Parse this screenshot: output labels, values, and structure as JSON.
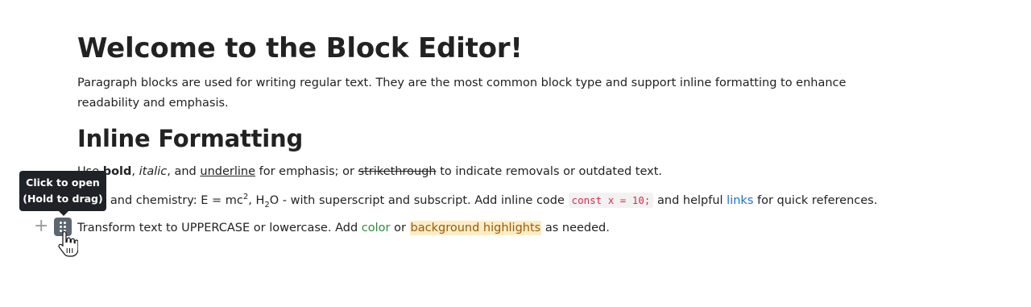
{
  "title": "Welcome to the Block Editor!",
  "intro": "Paragraph blocks are used for writing regular text. They are the most common block type and support inline formatting to enhance readability and emphasis.",
  "section_heading": "Inline Formatting",
  "line1": {
    "prefix": "Use ",
    "bold": "bold",
    "sep1": ", ",
    "italic": "italic",
    "sep2": ", and ",
    "underline": "underline",
    "mid": " for emphasis; or ",
    "strike": "strikethrough",
    "suffix": " to indicate removals or outdated text."
  },
  "line2": {
    "prefix": "Math and chemistry: E = mc",
    "sup": "2",
    "mid1": ", H",
    "sub": "2",
    "mid2": "O - with superscript and subscript. Add inline code ",
    "code": "const x = 10;",
    "mid3": " and helpful ",
    "link": "links",
    "suffix": " for quick references."
  },
  "line3": {
    "prefix": "Transform text to UPPERCASE or lowercase. Add ",
    "color": "color",
    "mid": " or ",
    "highlight": "background highlights",
    "suffix": " as needed."
  },
  "controls": {
    "plus_glyph": "+",
    "tooltip_line1": "Click to open",
    "tooltip_line2": "(Hold to drag)"
  },
  "colors": {
    "code_text": "#e0274f",
    "link": "#1a6fd8",
    "color_text": "#2f8a3a",
    "highlight_bg": "#fbedc5",
    "handle_bg": "#5d6670",
    "tooltip_bg": "#1f2327"
  },
  "icons": {
    "add_block": "plus-icon",
    "drag_handle": "drag-handle-icon",
    "cursor": "hand-pointer-icon"
  }
}
